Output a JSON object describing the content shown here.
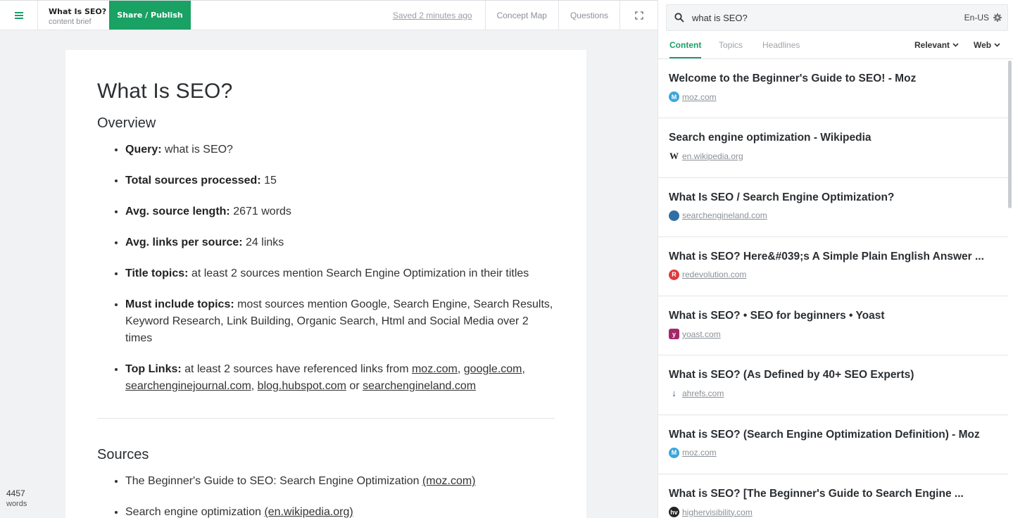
{
  "topbar": {
    "doc_title": "What Is SEO?",
    "doc_subtitle": "content brief",
    "share_label": "Share / Publish",
    "saved_label": "Saved 2 minutes ago",
    "concept_map_label": "Concept Map",
    "questions_label": "Questions"
  },
  "document": {
    "title": "What Is SEO?",
    "overview_heading": "Overview",
    "overview": [
      {
        "label": "Query:",
        "value": " what is SEO?"
      },
      {
        "label": "Total sources processed:",
        "value": " 15"
      },
      {
        "label": "Avg. source length:",
        "value": " 2671 words"
      },
      {
        "label": "Avg. links per source:",
        "value": " 24 links"
      },
      {
        "label": "Title topics:",
        "value": " at least 2 sources mention Search Engine Optimization in their titles"
      },
      {
        "label": "Must include topics:",
        "value": " most sources mention Google, Search Engine, Search Results, Keyword Research, Link Building, Organic Search, Html and Social Media over 2 times"
      }
    ],
    "top_links": {
      "label": "Top Links:",
      "prefix": " at least 2 sources have referenced links from ",
      "links": [
        "moz.com",
        "google.com",
        "searchenginejournal.com",
        "blog.hubspot.com",
        "searchengineland.com"
      ],
      "or": " or "
    },
    "sources_heading": "Sources",
    "sources": [
      {
        "text": "The Beginner's Guide to SEO: Search Engine Optimization ",
        "domain": "(moz.com)"
      },
      {
        "text": "Search engine optimization ",
        "domain": "(en.wikipedia.org)"
      }
    ]
  },
  "wordcount": {
    "value": "4457",
    "label": "words"
  },
  "panel": {
    "search_value": "what is SEO?",
    "locale": "En-US",
    "tabs": [
      "Content",
      "Topics",
      "Headlines"
    ],
    "sort": "Relevant",
    "source": "Web",
    "results": [
      {
        "title": "Welcome to the Beginner's Guide to SEO! - Moz",
        "domain": "moz.com",
        "icon": "moz-icon",
        "color": "#3aa6dc"
      },
      {
        "title": "Search engine optimization - Wikipedia",
        "domain": "en.wikipedia.org",
        "icon": "wikipedia-icon",
        "color": "#ffffff"
      },
      {
        "title": "What Is SEO / Search Engine Optimization?",
        "domain": "searchengineland.com",
        "icon": "searchengineland-icon",
        "color": "#2f6fa5"
      },
      {
        "title": "What is SEO? Here&#039;s A Simple Plain English Answer ...",
        "domain": "redevolution.com",
        "icon": "redevolution-icon",
        "color": "#e03a3e"
      },
      {
        "title": "What is SEO? • SEO for beginners • Yoast",
        "domain": "yoast.com",
        "icon": "yoast-icon",
        "color": "#a4286a"
      },
      {
        "title": "What is SEO? (As Defined by 40+ SEO Experts)",
        "domain": "ahrefs.com",
        "icon": "ahrefs-icon",
        "color": "#1f4e8c"
      },
      {
        "title": "What is SEO? (Search Engine Optimization Definition) - Moz",
        "domain": "moz.com",
        "icon": "moz-icon",
        "color": "#3aa6dc"
      },
      {
        "title": "What is SEO? [The Beginner's Guide to Search Engine ...",
        "domain": "highervisibility.com",
        "icon": "highervisibility-icon",
        "color": "#222222"
      }
    ]
  }
}
